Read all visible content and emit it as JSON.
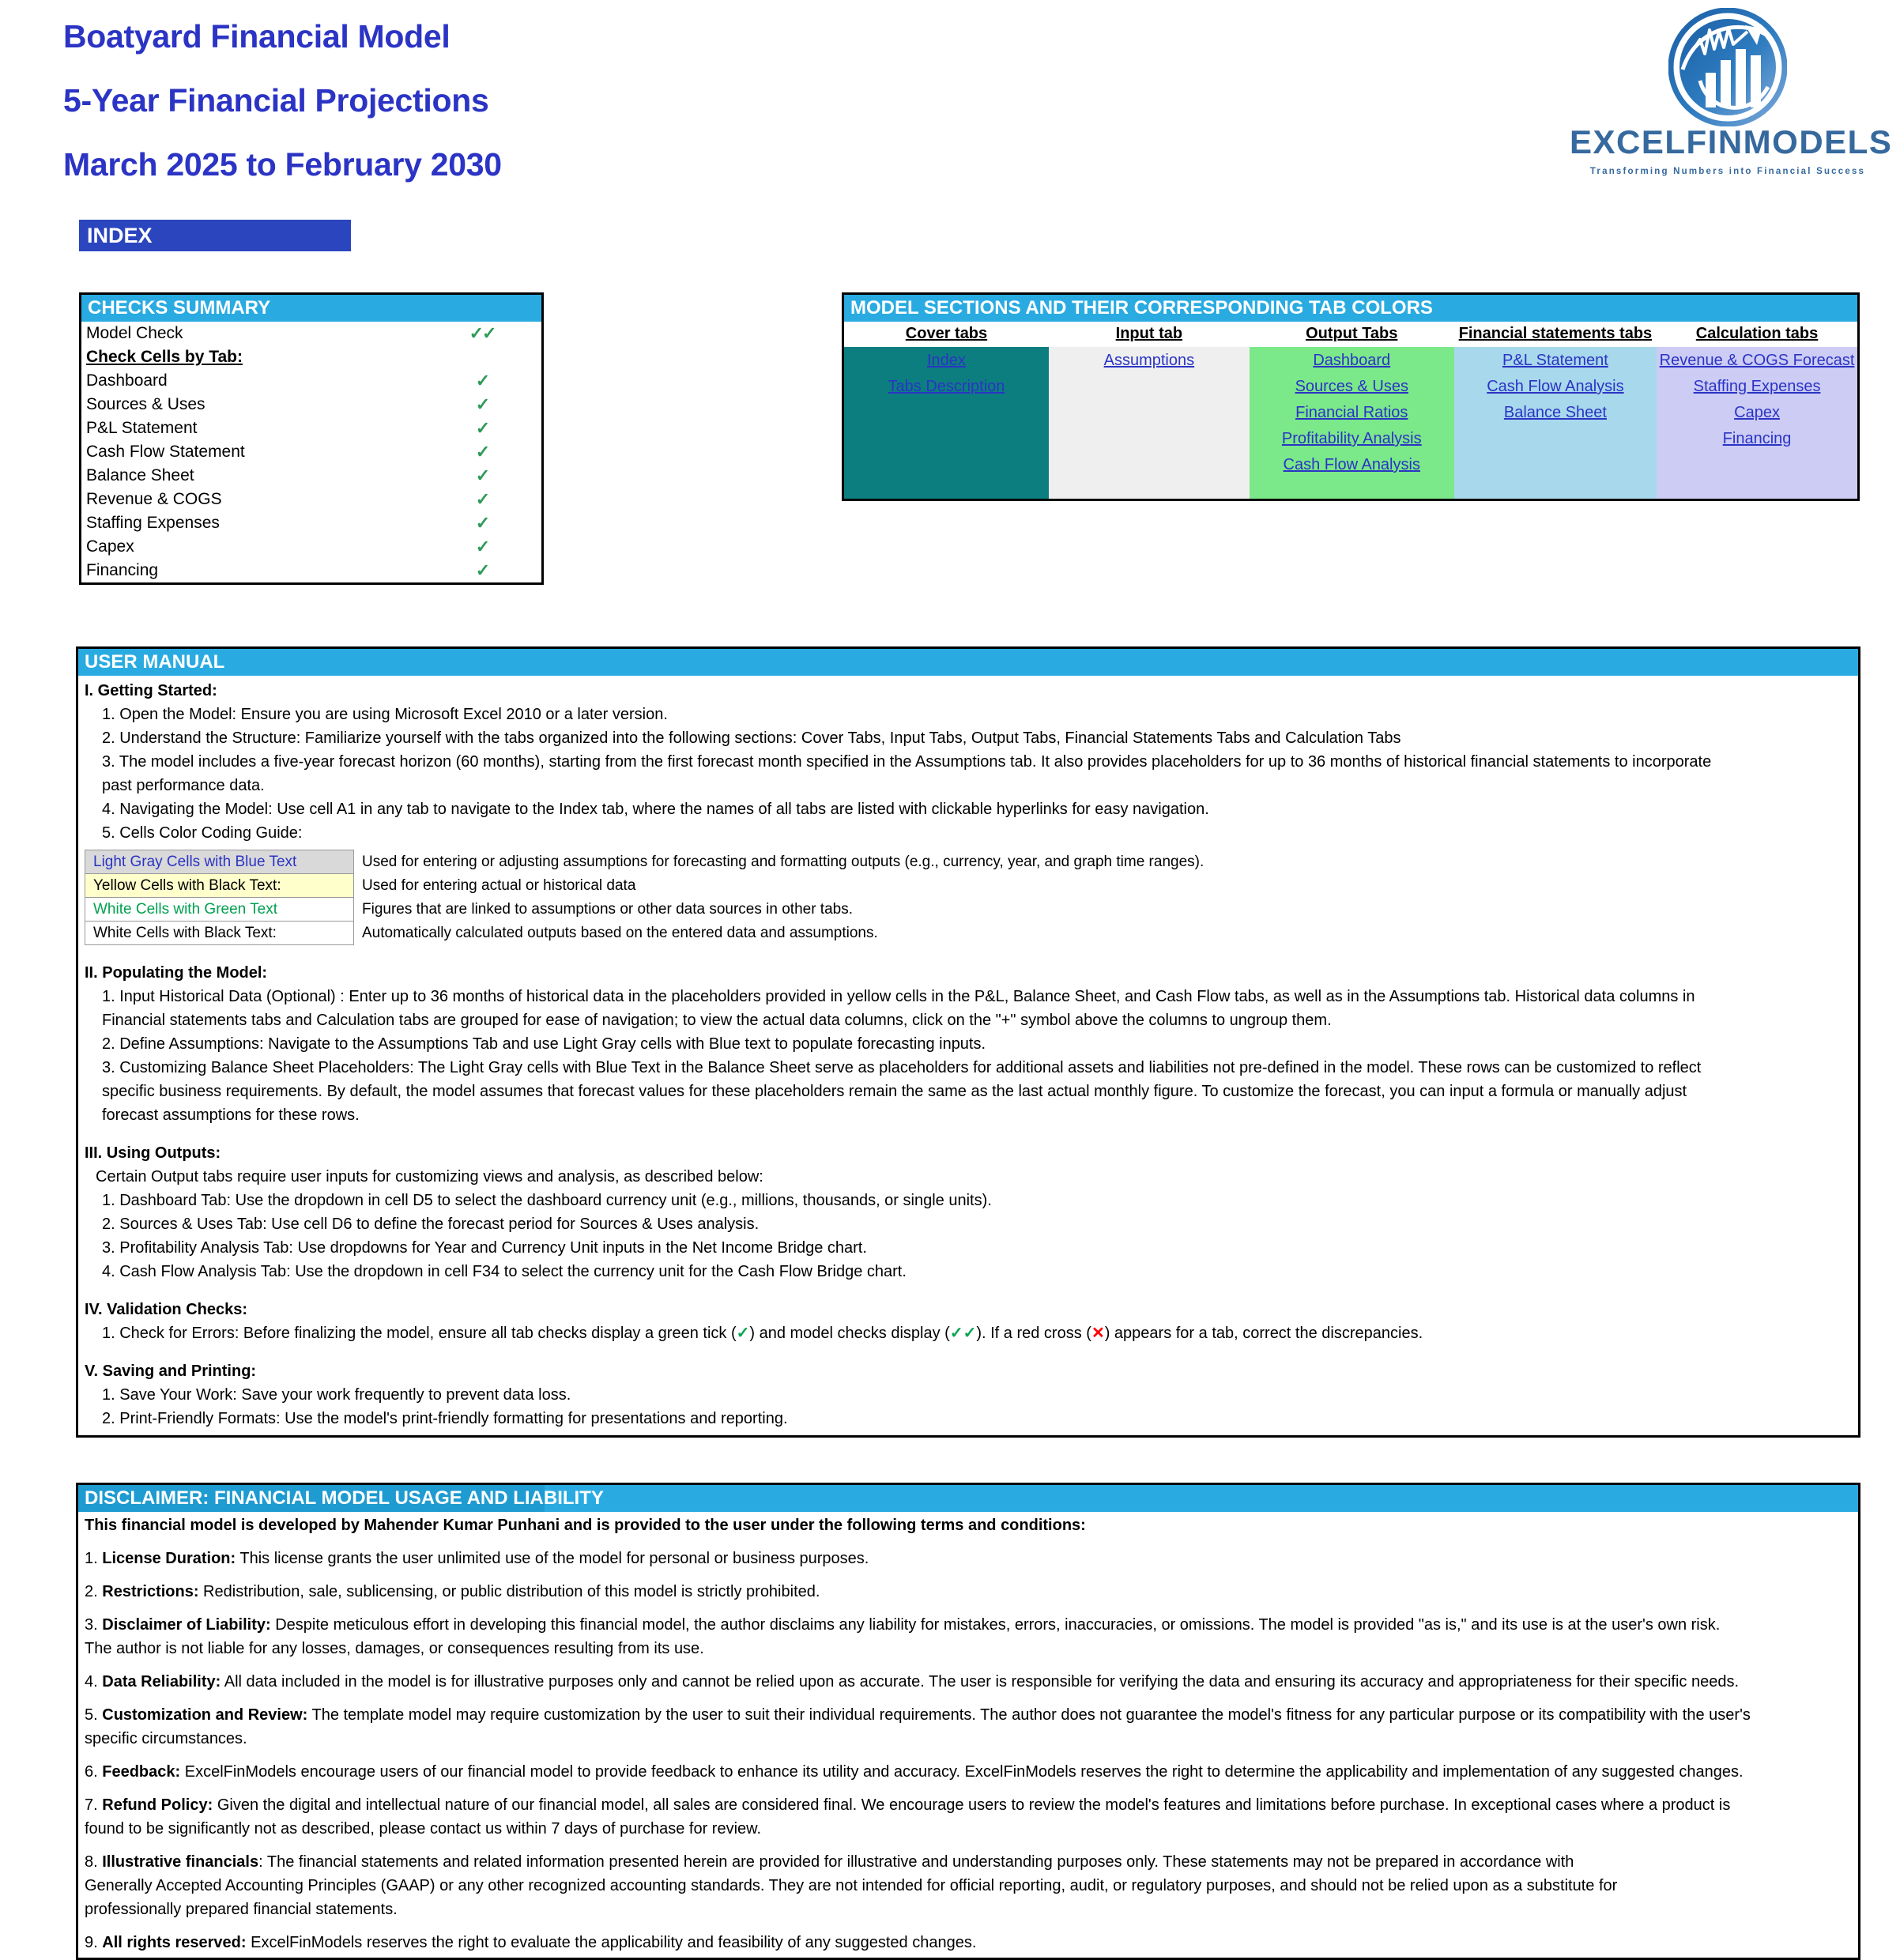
{
  "header": {
    "title_lines": [
      "Boatyard Financial Model",
      "5-Year Financial Projections",
      "March 2025 to February 2030"
    ],
    "index_badge": "INDEX",
    "logo_name": "EXCELFINMODELS",
    "logo_tagline": "Transforming Numbers into Financial Success",
    "brand_color": "#36699E",
    "title_color": "#2B34C4",
    "badge_color": "#2B45BE"
  },
  "checks": {
    "panel_title": "CHECKS  SUMMARY",
    "model_check_label": "Model Check",
    "model_check_mark": "✓✓",
    "subheading": "Check Cells by Tab:",
    "tick_mark": "✓",
    "tick_color": "#2E9B57",
    "rows": [
      "Dashboard",
      "Sources & Uses",
      "P&L Statement",
      "Cash Flow Statement",
      "Balance Sheet",
      "Revenue & COGS",
      "Staffing Expenses",
      "Capex",
      "Financing"
    ]
  },
  "sections": {
    "panel_title": "MODEL SECTIONS AND THEIR CORRESPONDING TAB COLORS",
    "columns": [
      {
        "header": "Cover tabs",
        "color": "#0C7E80",
        "links": [
          "Index",
          "Tabs Description"
        ]
      },
      {
        "header": "Input tab",
        "color": "#EFEFEF",
        "links": [
          "Assumptions "
        ]
      },
      {
        "header": "Output Tabs",
        "color": "#7BE88A",
        "links": [
          "Dashboard",
          "Sources & Uses",
          "Financial Ratios ",
          "Profitability Analysis",
          "Cash Flow Analysis"
        ]
      },
      {
        "header": "Financial statements tabs",
        "color": "#A8D8EC",
        "links": [
          "P&L Statement",
          "Cash Flow Analysis",
          "Balance Sheet"
        ]
      },
      {
        "header": "Calculation tabs",
        "color": "#CCCCF5",
        "links": [
          "Revenue & COGS Forecast",
          "Staffing Expenses",
          "Capex",
          "Financing"
        ]
      }
    ]
  },
  "manual": {
    "panel_title": "USER MANUAL",
    "section1_heading": "I. Getting Started:",
    "section1_lines": [
      "1. Open the Model: Ensure you are using Microsoft Excel 2010 or a later version.",
      "2. Understand the Structure: Familiarize yourself with the tabs organized into the following sections: Cover Tabs, Input Tabs, Output Tabs, Financial Statements Tabs and  Calculation Tabs",
      "3. The model includes a five-year forecast horizon (60 months), starting from the first forecast month specified in the Assumptions tab. It also provides placeholders for up to 36 months of historical financial statements to incorporate",
      "past performance data.",
      "4. Navigating the Model: Use cell A1 in any tab to navigate to the Index tab, where the names of all tabs are listed with clickable hyperlinks for easy navigation.",
      "5. Cells Color Coding Guide:"
    ],
    "color_guide": [
      {
        "key": "Light Gray Cells with Blue Text",
        "desc": "Used for entering or adjusting assumptions for forecasting and formatting outputs (e.g., currency, year, and graph time ranges)."
      },
      {
        "key": "Yellow Cells with Black Text:",
        "desc": "Used for entering actual or historical data"
      },
      {
        "key": "White Cells with Green Text",
        "desc": "Figures that are linked to assumptions or other data sources in other tabs."
      },
      {
        "key": "White Cells with Black Text:",
        "desc": "Automatically calculated outputs based on the entered data and assumptions."
      }
    ],
    "section2_heading": "II. Populating the Model:",
    "section2_lines": [
      "1. Input Historical Data (Optional) : Enter up to 36 months of historical data in the placeholders provided in yellow cells in the P&L, Balance Sheet, and Cash Flow tabs, as well as in the Assumptions tab. Historical data columns in",
      "Financial statements tabs and Calculation tabs are grouped for ease of navigation; to view the actual data columns, click on the \"+\" symbol above the columns to ungroup them.",
      "2. Define Assumptions: Navigate to the Assumptions Tab and use Light Gray cells with Blue text to populate forecasting inputs.",
      "3. Customizing Balance Sheet Placeholders: The Light Gray cells with Blue Text in the Balance Sheet serve as placeholders for additional assets and liabilities not pre-defined in the model. These rows can be customized to reflect",
      "specific business requirements. By default, the model assumes that forecast values for these placeholders remain the same as the last actual monthly figure. To customize the forecast, you can input a formula or manually adjust",
      "forecast assumptions for these rows."
    ],
    "section3_heading": "III. Using Outputs:",
    "section3_intro": "Certain Output tabs require user inputs for customizing views and analysis, as described below:",
    "section3_lines": [
      "1. Dashboard Tab: Use the dropdown in cell D5 to select the dashboard currency unit (e.g., millions, thousands, or single units).",
      "2. Sources & Uses Tab: Use cell D6 to define the forecast period for Sources & Uses analysis.",
      "3. Profitability Analysis Tab: Use dropdowns for Year and Currency Unit inputs in the Net Income Bridge chart.",
      "4. Cash Flow Analysis Tab: Use the dropdown in cell F34 to select the currency unit for the Cash Flow Bridge chart."
    ],
    "section4_heading": "IV. Validation Checks:",
    "section4_line_a": "1. Check for Errors:  Before finalizing the model, ensure all tab checks display a green tick (",
    "section4_tick": "✓",
    "section4_line_b": ") and model checks display  (",
    "section4_double_tick": "✓✓",
    "section4_line_c": "). If a red cross (",
    "section4_cross": "✕",
    "section4_line_d": ") appears for a tab, correct the discrepancies.",
    "section5_heading": "V. Saving and Printing:",
    "section5_lines": [
      "1. Save Your Work: Save your work frequently to prevent data loss.",
      "2. Print-Friendly Formats: Use the model's print-friendly formatting for presentations and reporting."
    ]
  },
  "disclaimer": {
    "panel_title": "DISCLAIMER: FINANCIAL MODEL USAGE AND LIABILITY",
    "intro": "This financial model  is developed by Mahender Kumar Punhani and is provided to the user under the following terms and conditions:",
    "items": [
      {
        "num": "1. ",
        "term": "License Duration:",
        "text": " This license grants the user unlimited use of the model for personal or business purposes."
      },
      {
        "num": "2. ",
        "term": "Restrictions:",
        "text": " Redistribution, sale, sublicensing, or public distribution of this model is strictly prohibited."
      },
      {
        "num": "3. ",
        "term": "Disclaimer of Liability:",
        "text": " Despite meticulous effort in developing this financial model, the author disclaims any liability for mistakes, errors, inaccuracies, or omissions. The model is provided \"as is,\" and its use is at the user's own risk."
      },
      {
        "num": "",
        "term": "",
        "text": "The author is not liable for  any losses, damages, or consequences resulting from its use."
      },
      {
        "num": "4. ",
        "term": "Data Reliability:",
        "text": " All data included in the model is for illustrative purposes only and cannot be relied upon as accurate. The user is  responsible for verifying the data and ensuring its accuracy and appropriateness for their specific needs."
      },
      {
        "num": "5. ",
        "term": "Customization and Review:",
        "text": " The template model may require customization by the user to suit their individual requirements. The author does not guarantee the model's fitness for any  particular purpose or its compatibility with the user's"
      },
      {
        "num": "",
        "term": "",
        "text": "specific circumstances."
      },
      {
        "num": "6. ",
        "term": "Feedback:",
        "text": " ExcelFinModels encourage users of our financial model to provide feedback to enhance its utility and accuracy. ExcelFinModels reserves the right to determine the applicability and implementation of any suggested changes."
      },
      {
        "num": "7. ",
        "term": "Refund Policy:",
        "text": " Given the digital and intellectual nature of our financial model, all sales are considered final. We encourage users to review the model's features and limitations before purchase. In exceptional cases where a product is"
      },
      {
        "num": "",
        "term": "",
        "text": "found to be  significantly not as described, please contact us within 7 days of purchase for review."
      },
      {
        "num": "8. ",
        "term": "Illustrative financials",
        "text": ": The financial statements and related information presented herein are provided for illustrative and understanding purposes only. These statements may not be prepared in accordance with"
      },
      {
        "num": "",
        "term": "",
        "text": "Generally Accepted Accounting Principles (GAAP)  or any other  recognized accounting standards. They are not intended for official reporting, audit, or regulatory purposes, and should not be relied upon as a substitute for"
      },
      {
        "num": "",
        "term": "",
        "text": "professionally prepared financial statements."
      },
      {
        "num": "9. ",
        "term": "All rights reserved:",
        "text": " ExcelFinModels reserves the right to evaluate the applicability and feasibility of any suggested changes."
      }
    ]
  }
}
